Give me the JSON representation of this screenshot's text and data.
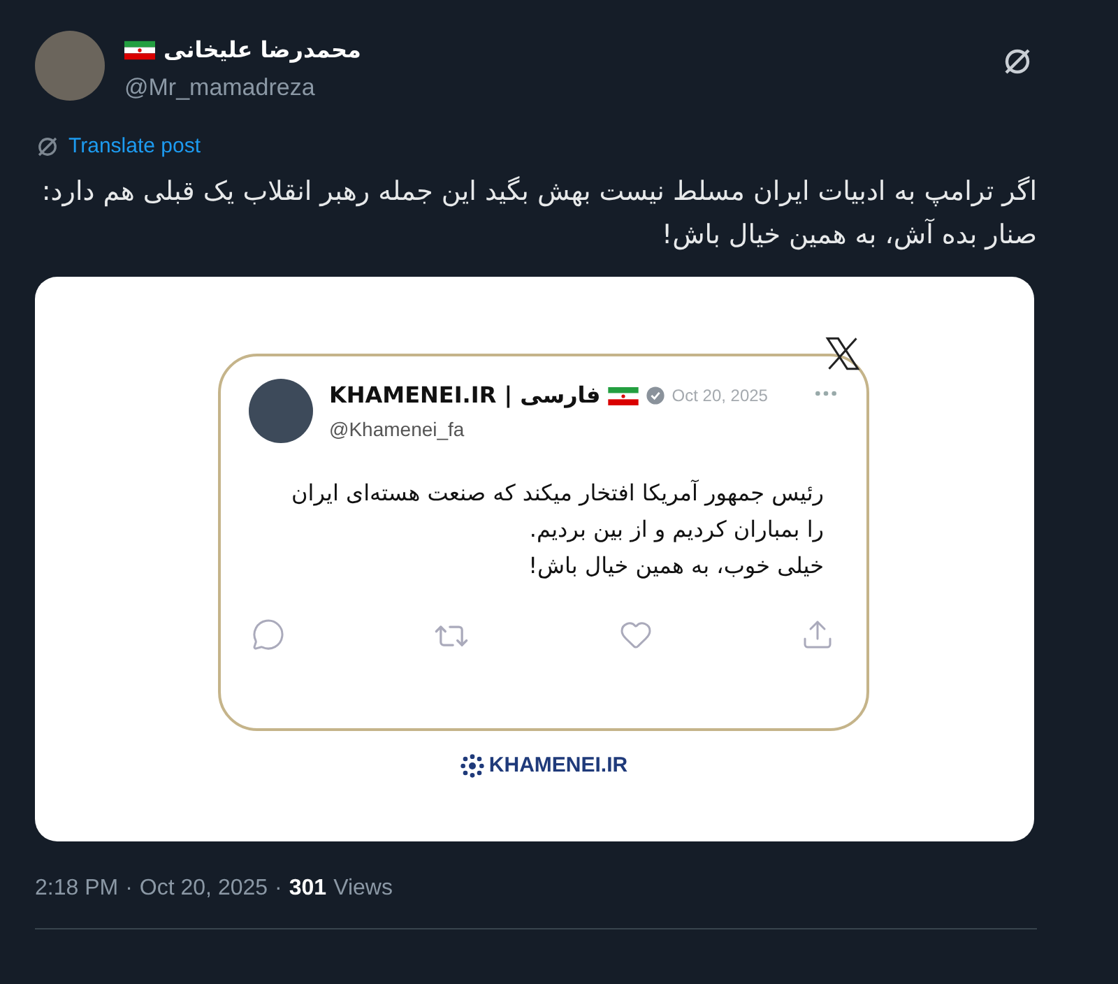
{
  "author": {
    "name": "محمدرضا علیخانی",
    "handle": "@Mr_mamadreza"
  },
  "translate_link": "Translate post",
  "post_text": [
    "اگر ترامپ به ادبیات ایران مسلط نیست بهش بگید این جمله رهبر انقلاب یک قبلی هم دارد:",
    "صنار بده آش، به همین خیال باش!"
  ],
  "embedded_post": {
    "name": "KHAMENEI.IR | فارسی",
    "verified": true,
    "date": "Oct 20, 2025",
    "handle": "@Khamenei_fa",
    "lines": [
      "رئیس جمهور آمریکا افتخار میکند که صنعت هسته‌ای ایران",
      "را بمباران کردیم و از بین بردیم.",
      "خیلی خوب، به همین خیال باش!"
    ]
  },
  "image_footer_logo": "KHAMENEI.IR",
  "meta": {
    "time": "2:18 PM",
    "separator": "·",
    "date": "Oct 20, 2025",
    "views_count": "301",
    "views_label": "Views"
  }
}
